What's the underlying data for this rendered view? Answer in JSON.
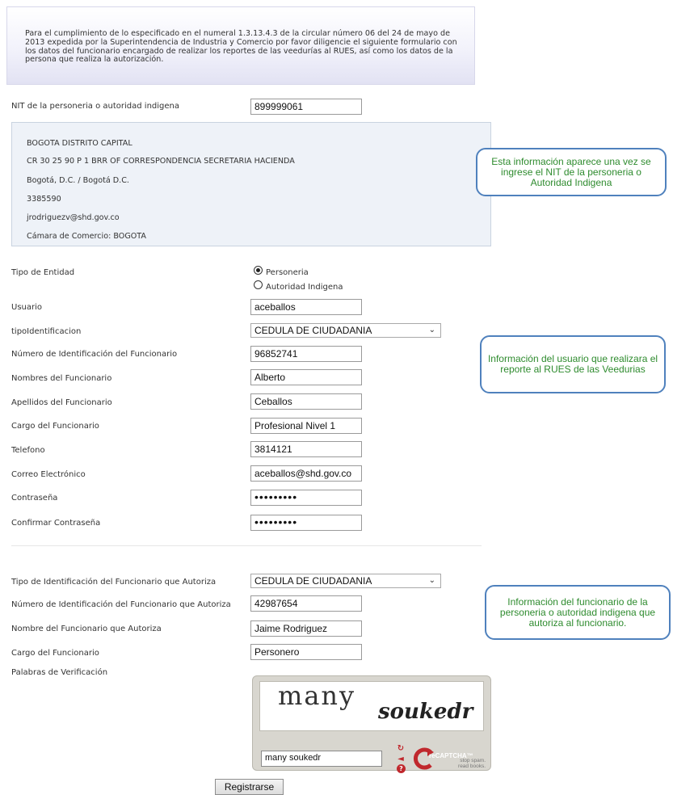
{
  "intro_text": "Para el cumplimiento de lo especificado en el numeral 1.3.13.4.3 de la circular número 06 del 24 de mayo de 2013 expedida por la Superintendencia de Industria y Comercio por favor diligencie el siguiente formulario con los datos del funcionario encargado de realizar los reportes de las veedurías al RUES, así como los datos de la persona que realiza la autorización.",
  "nit": {
    "label": "NIT de la personeria o autoridad indigena",
    "value": "899999061"
  },
  "entity_info": {
    "name": "BOGOTA DISTRITO CAPITAL",
    "address": "CR 30 25 90 P 1 BRR OF CORRESPONDENCIA SECRETARIA HACIENDA",
    "city": "Bogotá, D.C. / Bogotá D.C.",
    "phone": "3385590",
    "email": "jrodriguezv@shd.gov.co",
    "chamber": "Cámara de Comercio:  BOGOTA"
  },
  "callouts": {
    "nit_info": "Esta información aparece una vez se ingrese el NIT de la personeria o Autoridad Indigena",
    "user_info": "Información del usuario que realizara el reporte al RUES de las Veedurias",
    "authorizer_info": "Información del funcionario de la personeria o autoridad indigena que autoriza al funcionario."
  },
  "entity_type": {
    "label": "Tipo de Entidad",
    "options": [
      "Personeria",
      "Autoridad Indigena"
    ],
    "selected": "Personeria"
  },
  "user_fields": [
    {
      "label": "Usuario",
      "value": "aceballos"
    },
    {
      "label": "Número de Identificación del Funcionario",
      "value": "96852741"
    },
    {
      "label": "Nombres del Funcionario",
      "value": "Alberto"
    },
    {
      "label": "Apellidos del Funcionario",
      "value": "Ceballos"
    },
    {
      "label": "Cargo del Funcionario",
      "value": "Profesional Nivel 1"
    },
    {
      "label": "Telefono",
      "value": "3814121"
    },
    {
      "label": "Correo Electrónico",
      "value": "aceballos@shd.gov.co"
    },
    {
      "label": "Contraseña",
      "value": "•••••••••"
    },
    {
      "label": "Confirmar Contraseña",
      "value": "•••••••••"
    }
  ],
  "id_type": {
    "label": "tipoIdentificacion",
    "value": "CEDULA DE CIUDADANIA"
  },
  "authorizer": {
    "id_type": {
      "label": "Tipo de Identificación del Funcionario que Autoriza",
      "value": "CEDULA DE CIUDADANIA"
    },
    "id_number": {
      "label": "Número de Identificación del Funcionario que Autoriza",
      "value": "42987654"
    },
    "name": {
      "label": "Nombre del Funcionario que Autoriza",
      "value": "Jaime Rodriguez"
    },
    "position": {
      "label": "Cargo del Funcionario",
      "value": "Personero"
    }
  },
  "captcha": {
    "label": "Palabras de Verificación",
    "word1": "many",
    "word2": "soukedr",
    "input_value": "many soukedr",
    "brand": "reCAPTCHA™",
    "tagline": "stop spam. read books."
  },
  "submit_label": "Registrarse",
  "colors": {
    "callout_border": "#4f81bd",
    "callout_text": "#2e8b2e",
    "captcha_red": "#c0282d"
  }
}
